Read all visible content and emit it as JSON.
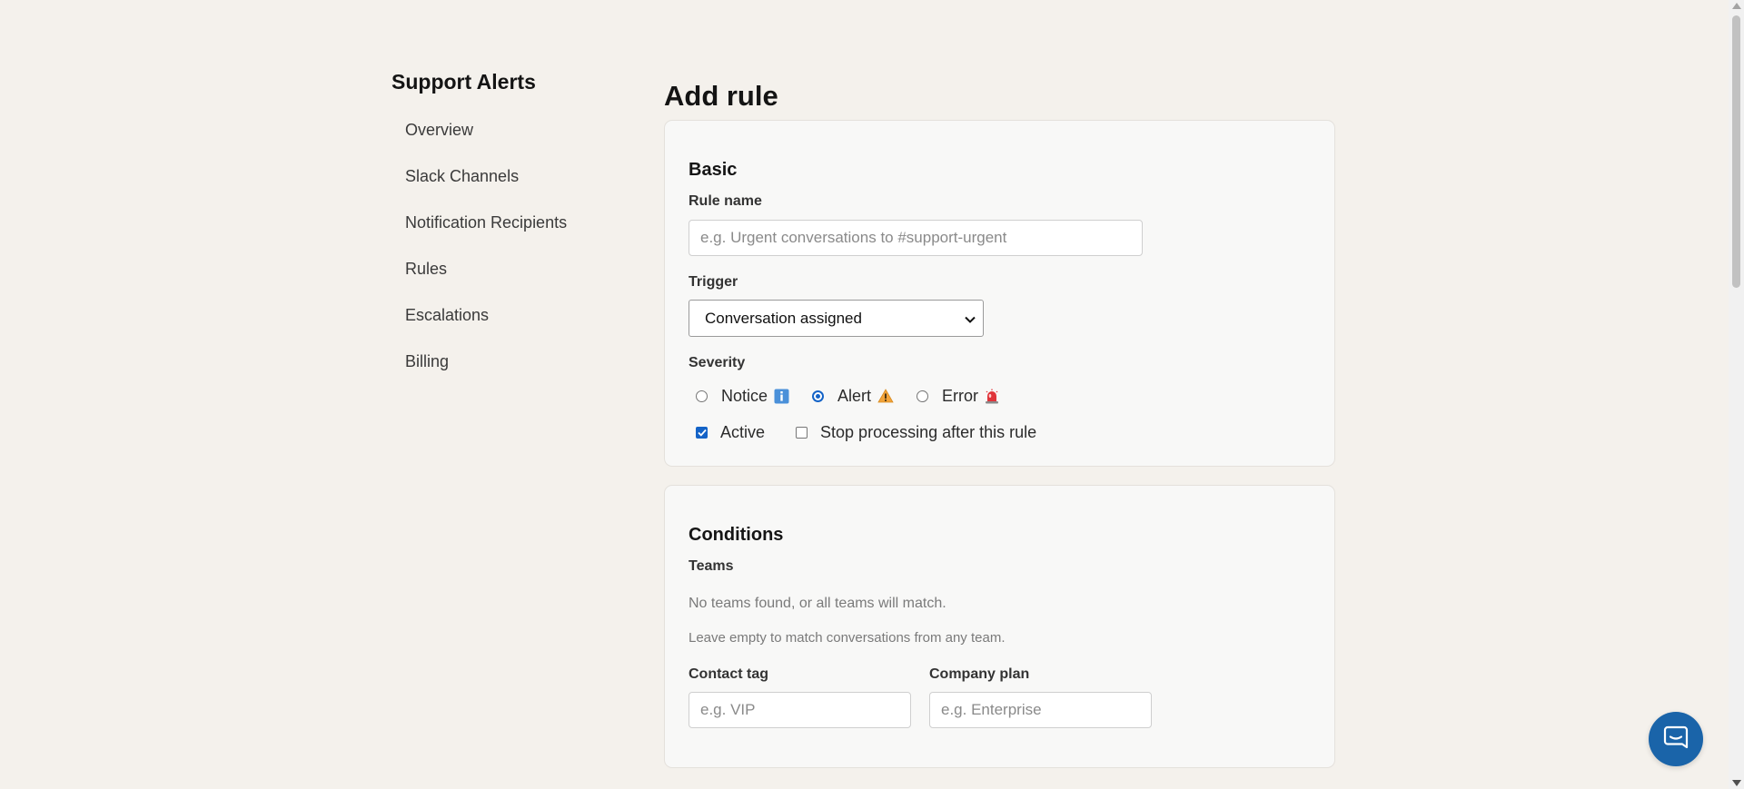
{
  "sidebar": {
    "title": "Support Alerts",
    "items": [
      {
        "label": "Overview"
      },
      {
        "label": "Slack Channels"
      },
      {
        "label": "Notification Recipients"
      },
      {
        "label": "Rules"
      },
      {
        "label": "Escalations"
      },
      {
        "label": "Billing"
      }
    ]
  },
  "main": {
    "title": "Add rule",
    "basic": {
      "heading": "Basic",
      "rule_name_label": "Rule name",
      "rule_name_placeholder": "e.g. Urgent conversations to #support-urgent",
      "rule_name_value": "",
      "trigger_label": "Trigger",
      "trigger_value": "Conversation assigned",
      "severity_label": "Severity",
      "severity_options": [
        {
          "label": "Notice",
          "icon": "info-icon",
          "selected": false
        },
        {
          "label": "Alert",
          "icon": "warning-icon",
          "selected": true
        },
        {
          "label": "Error",
          "icon": "siren-icon",
          "selected": false
        }
      ],
      "active_label": "Active",
      "active_checked": true,
      "stop_label": "Stop processing after this rule",
      "stop_checked": false
    },
    "conditions": {
      "heading": "Conditions",
      "teams_label": "Teams",
      "teams_empty": "No teams found, or all teams will match.",
      "teams_hint": "Leave empty to match conversations from any team.",
      "contact_tag_label": "Contact tag",
      "contact_tag_placeholder": "e.g. VIP",
      "company_plan_label": "Company plan",
      "company_plan_placeholder": "e.g. Enterprise"
    }
  },
  "colors": {
    "background": "#f4f1ec",
    "accent": "#1463c7",
    "chat_button": "#1a64a9"
  }
}
